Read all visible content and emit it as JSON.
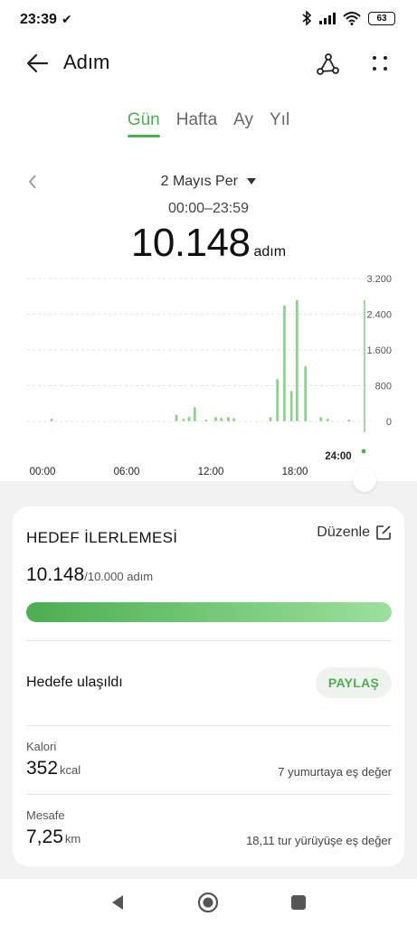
{
  "status_bar": {
    "time": "23:39",
    "battery": "63"
  },
  "header": {
    "title": "Adım"
  },
  "tabs": [
    {
      "label": "Gün",
      "active": true
    },
    {
      "label": "Hafta",
      "active": false
    },
    {
      "label": "Ay",
      "active": false
    },
    {
      "label": "Yıl",
      "active": false
    }
  ],
  "date": {
    "label": "2 Mayıs Per",
    "dropdown_icon": "caret-down-icon"
  },
  "summary": {
    "time_range": "00:00–23:59",
    "steps": "10.148",
    "unit": "adım"
  },
  "chart_data": {
    "type": "bar",
    "y_ticks": [
      "3.200",
      "2.400",
      "1.600",
      "800",
      "0"
    ],
    "ylim": [
      0,
      3200
    ],
    "x_ticks": [
      "00:00",
      "06:00",
      "12:00",
      "18:00",
      "24:00"
    ],
    "xlim": [
      0,
      24
    ],
    "color": "#8fd18f",
    "grid": "horizontal dashed",
    "bars": [
      {
        "x": 1.3,
        "value": 60
      },
      {
        "x": 10.2,
        "value": 150
      },
      {
        "x": 10.7,
        "value": 60
      },
      {
        "x": 11.1,
        "value": 110
      },
      {
        "x": 11.5,
        "value": 320
      },
      {
        "x": 12.3,
        "value": 40
      },
      {
        "x": 13.0,
        "value": 100
      },
      {
        "x": 13.4,
        "value": 80
      },
      {
        "x": 13.9,
        "value": 100
      },
      {
        "x": 14.3,
        "value": 70
      },
      {
        "x": 16.9,
        "value": 100
      },
      {
        "x": 17.4,
        "value": 950
      },
      {
        "x": 17.9,
        "value": 2600
      },
      {
        "x": 18.4,
        "value": 680
      },
      {
        "x": 18.8,
        "value": 2720
      },
      {
        "x": 19.4,
        "value": 1240
      },
      {
        "x": 20.5,
        "value": 100
      },
      {
        "x": 21.0,
        "value": 60
      },
      {
        "x": 22.5,
        "value": 40
      }
    ]
  },
  "goal": {
    "title": "HEDEF İLERLEMESİ",
    "edit_label": "Düzenle",
    "current": "10.148",
    "total": "/10.000 adım",
    "progress": 1.0,
    "reached_label": "Hedefe ulaşıldı",
    "share_label": "PAYLAŞ"
  },
  "metrics": {
    "calories": {
      "label": "Kalori",
      "value": "352",
      "unit": "kcal",
      "note": "7 yumurtaya eş değer"
    },
    "distance": {
      "label": "Mesafe",
      "value": "7,25",
      "unit": "km",
      "note": "18,11 tur yürüyüşe eş değer"
    }
  },
  "colors": {
    "accent": "#4caf50",
    "bar": "#8fd18f",
    "panel_bg": "#f2f2f2"
  }
}
